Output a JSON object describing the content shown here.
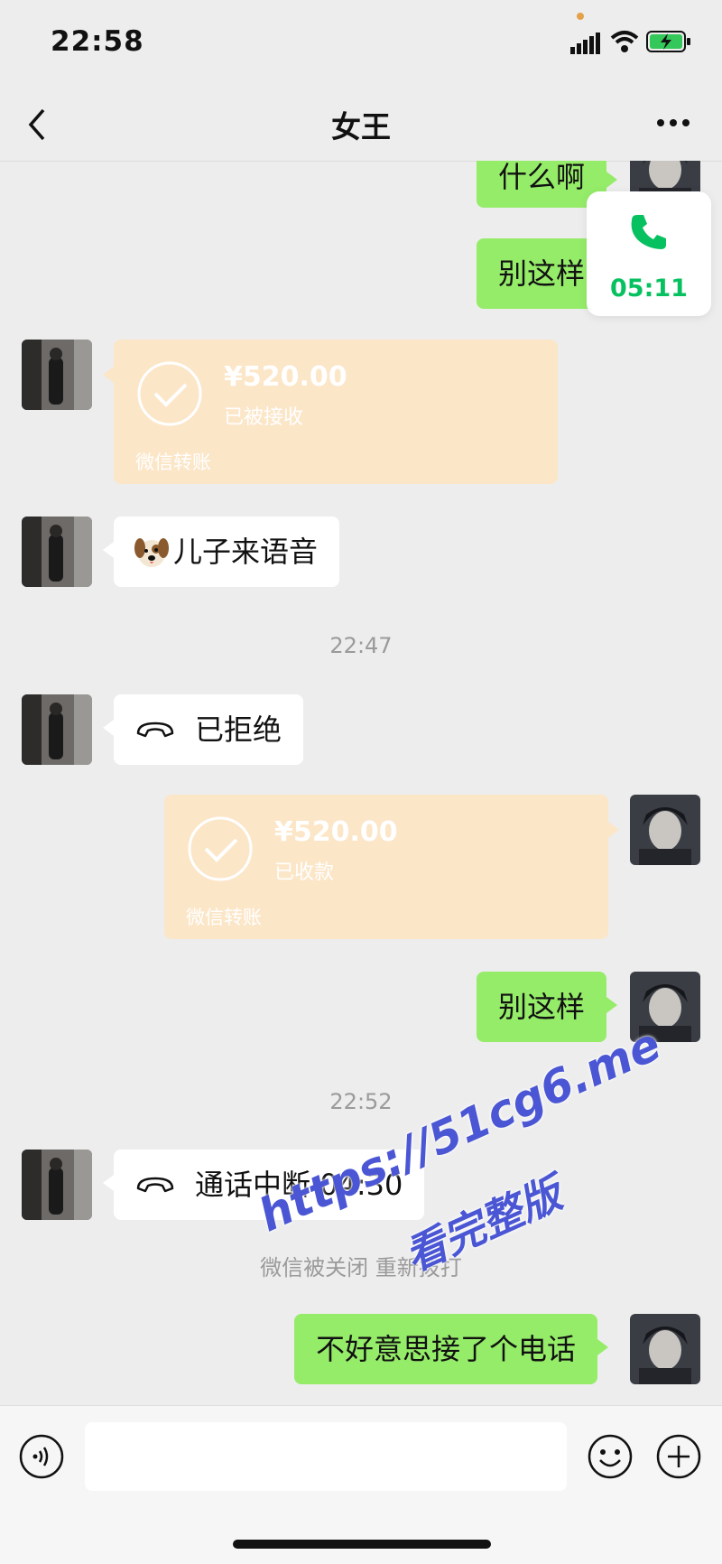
{
  "status_bar": {
    "time": "22:58",
    "icons": [
      "signal-icon",
      "wifi-icon",
      "battery-charging-icon"
    ]
  },
  "header": {
    "title": "女王",
    "back_icon": "chevron-left-icon",
    "more_icon": "more-horizontal-icon"
  },
  "call_widget": {
    "icon": "phone-icon",
    "duration": "05:11",
    "accent": "#07c160"
  },
  "messages": [
    {
      "side": "right",
      "type": "text",
      "text": "什么啊"
    },
    {
      "side": "right",
      "type": "text",
      "text": "别这样"
    },
    {
      "side": "left",
      "type": "transfer",
      "amount": "¥520.00",
      "status": "已被接收",
      "footer": "微信转账"
    },
    {
      "side": "left",
      "type": "text",
      "emoji": "dog-face-icon",
      "text": "儿子来语音"
    },
    {
      "type": "timestamp",
      "text": "22:47"
    },
    {
      "side": "left",
      "type": "call",
      "icon": "hang-up-icon",
      "text": "已拒绝"
    },
    {
      "side": "right",
      "type": "transfer",
      "amount": "¥520.00",
      "status": "已收款",
      "footer": "微信转账"
    },
    {
      "side": "right",
      "type": "text",
      "text": "别这样"
    },
    {
      "type": "timestamp",
      "text": "22:52"
    },
    {
      "side": "left",
      "type": "call",
      "icon": "hang-up-icon",
      "text": "通话中断 04:30"
    },
    {
      "type": "system",
      "text": "微信被关闭 重新拨打"
    },
    {
      "side": "right",
      "type": "text",
      "text": "不好意思接了个电话"
    }
  ],
  "watermark": {
    "line1": "https://51cg6.me",
    "line2": "看完整版"
  },
  "input_bar": {
    "voice_icon": "voice-mode-icon",
    "input_value": "",
    "emoji_icon": "emoji-icon",
    "plus_icon": "plus-circle-icon"
  },
  "colors": {
    "background": "#ededed",
    "own_bubble": "#95ec69",
    "other_bubble": "#ffffff",
    "transfer_card": "#fce6c8",
    "timestamp": "#9a9a9a"
  }
}
